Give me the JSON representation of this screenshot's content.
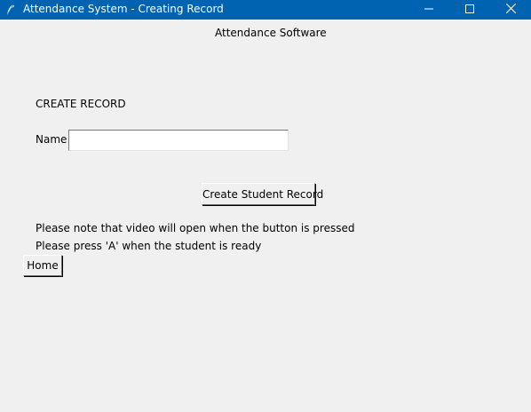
{
  "window": {
    "title": "Attendance System - Creating Record",
    "controls": {
      "minimize_icon": "minimize-icon",
      "maximize_icon": "maximize-icon",
      "close_icon": "close-icon"
    },
    "titlebar_color": "#0063b1"
  },
  "app": {
    "header": "Attendance Software",
    "section_title": "CREATE RECORD",
    "name_label": "Name",
    "name_value": "",
    "create_button": "Create Student Record",
    "note_video": "Please note that video will open when the button is pressed",
    "note_press": "Please press 'A' when the student is ready",
    "home_button": "Home"
  },
  "colors": {
    "background": "#f0f0f0",
    "titlebar": "#0063b1"
  }
}
